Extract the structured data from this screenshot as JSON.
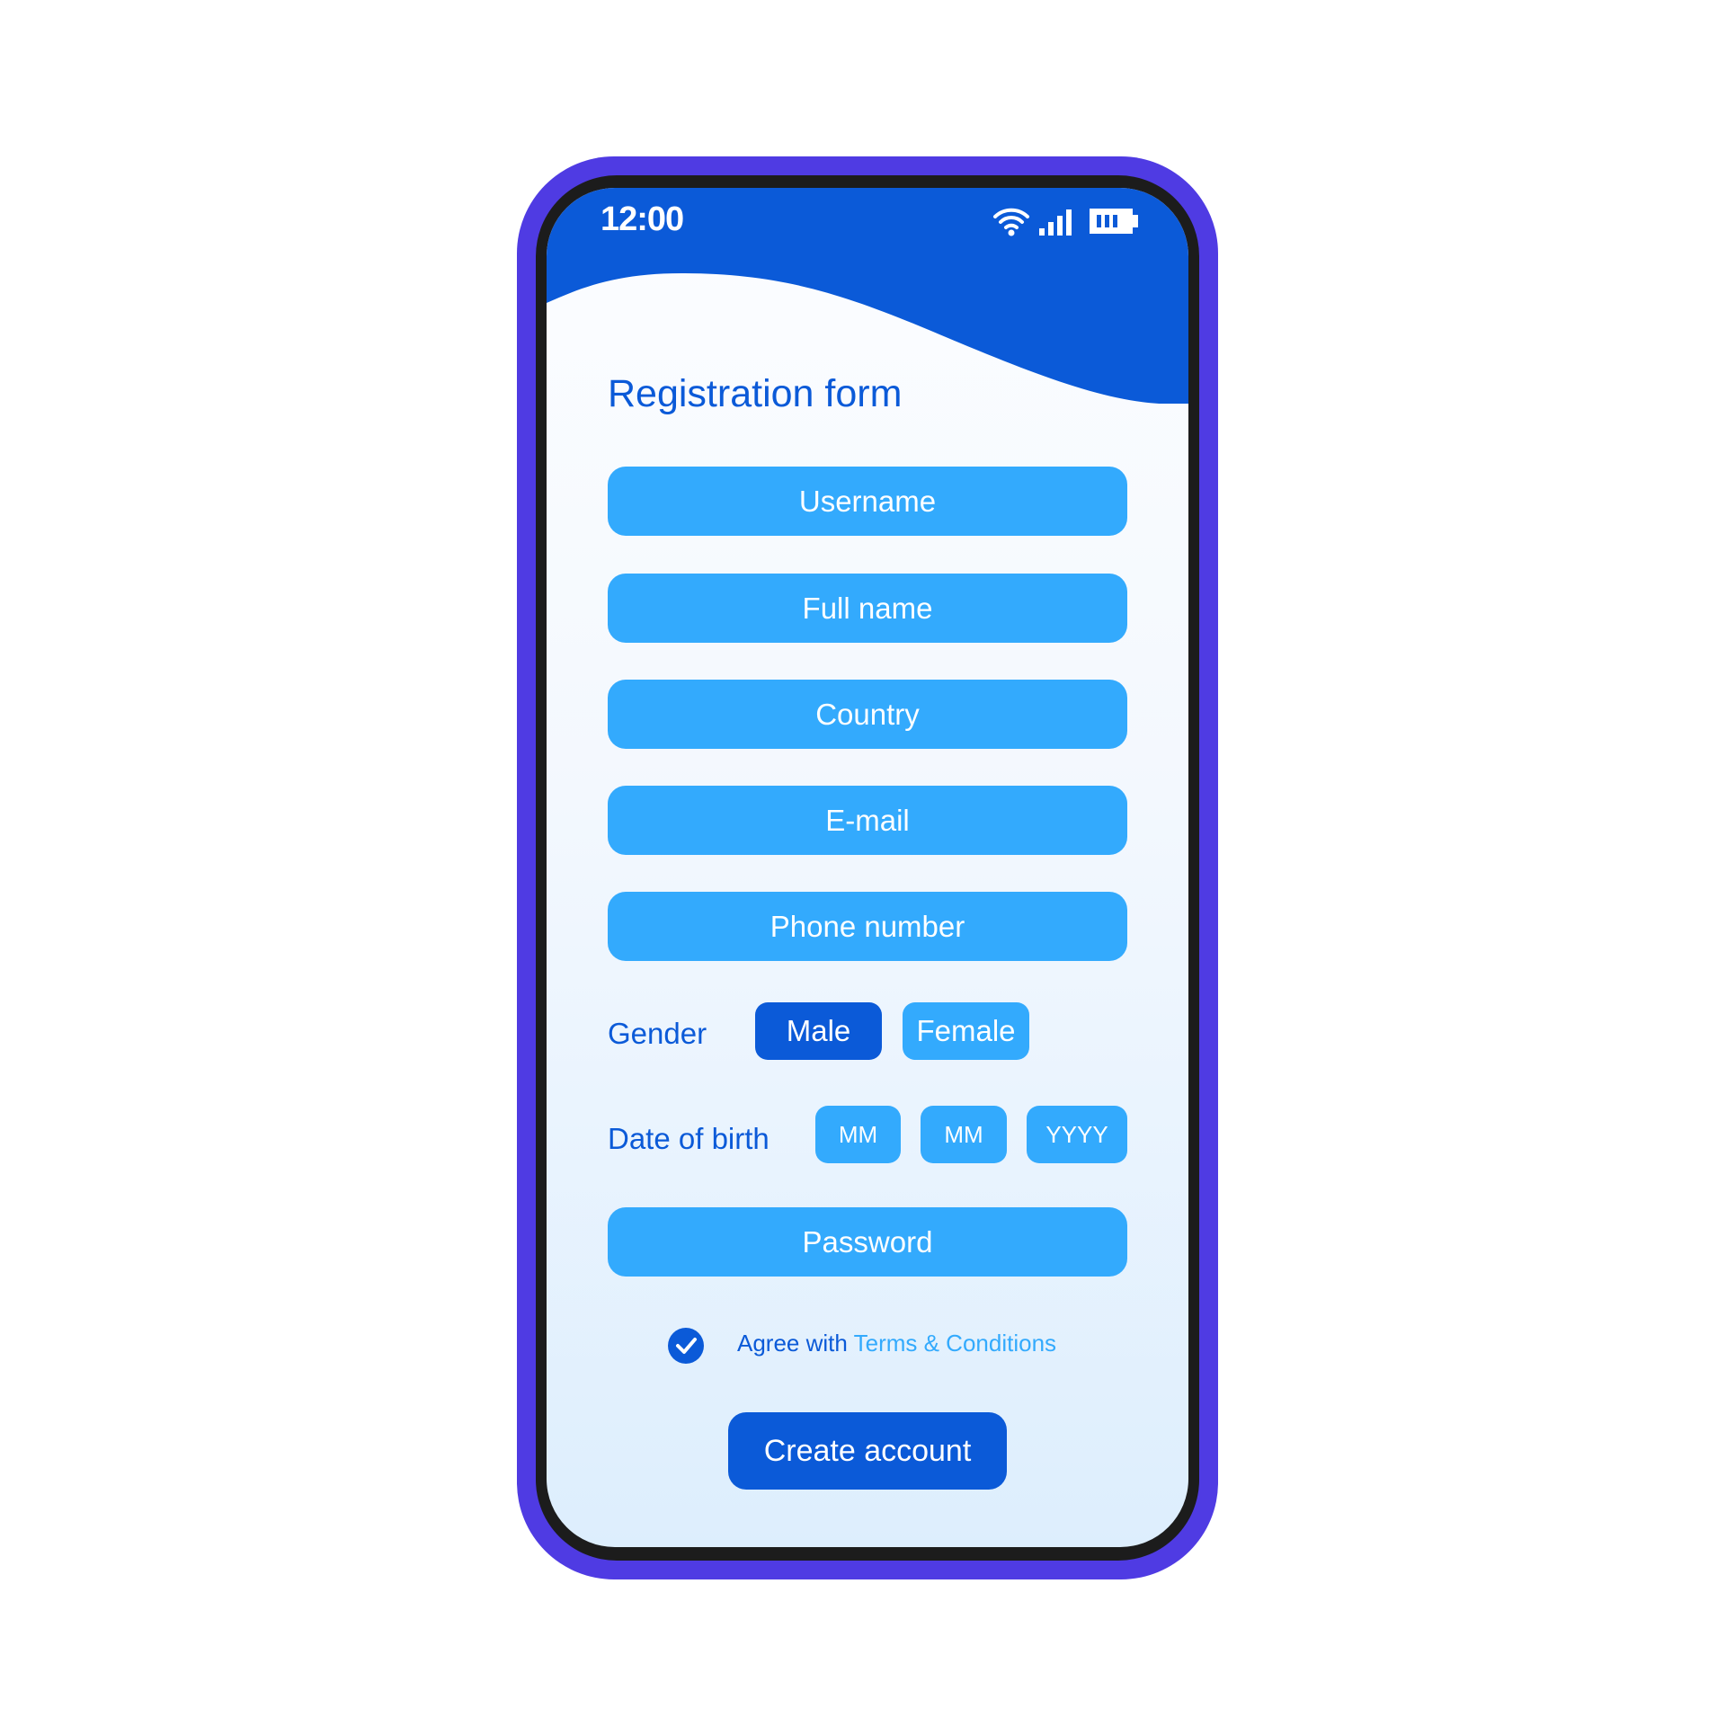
{
  "status_bar": {
    "time": "12:00",
    "icons": [
      "wifi-icon",
      "signal-icon",
      "battery-icon"
    ]
  },
  "colors": {
    "frame": "#4f3be3",
    "header": "#0b5ad8",
    "field": "#33aafd",
    "primary": "#0b5ad8",
    "link": "#33aafd"
  },
  "form": {
    "title": "Registration form",
    "fields": {
      "username": "Username",
      "full_name": "Full name",
      "country": "Country",
      "email": "E-mail",
      "phone": "Phone number",
      "password": "Password"
    },
    "gender": {
      "label": "Gender",
      "options": [
        "Male",
        "Female"
      ],
      "selected": "Male"
    },
    "dob": {
      "label": "Date of birth",
      "month": "MM",
      "day": "MM",
      "year": "YYYY"
    },
    "agree": {
      "checked": true,
      "text": "Agree with",
      "link": "Terms & Conditions"
    },
    "submit_label": "Create account"
  }
}
